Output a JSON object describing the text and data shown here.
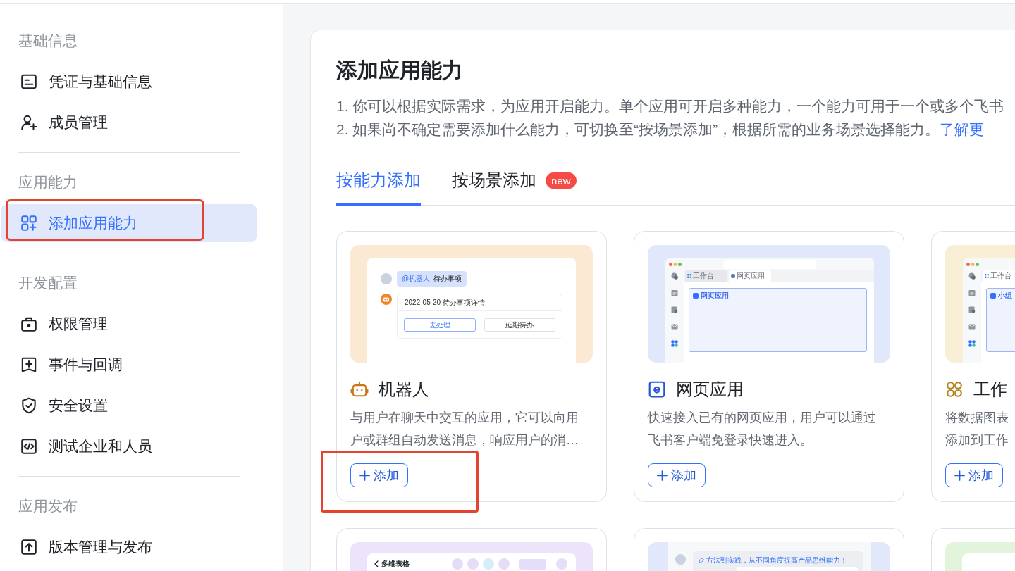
{
  "sidebar": {
    "sections": [
      {
        "title": "基础信息",
        "items": [
          {
            "label": "凭证与基础信息",
            "selected": false,
            "annotated": false
          },
          {
            "label": "成员管理",
            "selected": false,
            "annotated": false
          }
        ]
      },
      {
        "title": "应用能力",
        "items": [
          {
            "label": "添加应用能力",
            "selected": true,
            "annotated": true
          }
        ]
      },
      {
        "title": "开发配置",
        "items": [
          {
            "label": "权限管理",
            "selected": false,
            "annotated": false
          },
          {
            "label": "事件与回调",
            "selected": false,
            "annotated": false
          },
          {
            "label": "安全设置",
            "selected": false,
            "annotated": false
          },
          {
            "label": "测试企业和人员",
            "selected": false,
            "annotated": false
          }
        ]
      },
      {
        "title": "应用发布",
        "items": [
          {
            "label": "版本管理与发布",
            "selected": false,
            "annotated": false
          }
        ]
      }
    ]
  },
  "main": {
    "title": "添加应用能力",
    "notes": [
      {
        "text": "1. 你可以根据实际需求，为应用开启能力。单个应用可开启多种能力，一个能力可用于一个或多个飞书"
      },
      {
        "text": "2. 如果尚不确定需要添加什么能力，可切换至“按场景添加”，根据所需的业务场景选择能力。",
        "link": "了解更"
      }
    ],
    "tabs": [
      {
        "label": "按能力添加",
        "selected": true
      },
      {
        "label": "按场景添加",
        "selected": false,
        "badge": "new"
      }
    ],
    "cards": [
      {
        "kind": "bot",
        "title": "机器人",
        "description_lines": [
          "与用户在聊天中交互的应用，它可以向用",
          "户或群组自动发送消息，响应用户的消…"
        ],
        "button": "添加",
        "annotated": true,
        "illustration": {
          "kind": "chat",
          "color": "#fbe9d4",
          "mention": "@机器人",
          "message": "待办事项",
          "card_title": "2022-05-20 待办事项详情",
          "buttons": [
            {
              "label": "去处理",
              "primary": true
            },
            {
              "label": "延期待办",
              "primary": false
            }
          ]
        }
      },
      {
        "kind": "web_app",
        "title": "网页应用",
        "description_lines": [
          "快速接入已有的网页应用，用户可以通过",
          "飞书客户端免登录快速进入。"
        ],
        "button": "添加",
        "annotated": false,
        "illustration": {
          "kind": "window",
          "color": "#e1e8fb",
          "address_bar": true,
          "tabs": [
            {
              "label": "工作台",
              "kind": "apps",
              "selected": false
            },
            {
              "label": "网页应用",
              "kind": "page",
              "selected": true
            }
          ],
          "panel_title": "网页应用"
        }
      },
      {
        "kind": "workplace",
        "title": "工作",
        "description_lines": [
          "将数据图表",
          "添加到工作"
        ],
        "button": "添加",
        "annotated": false,
        "illustration": {
          "kind": "window",
          "color": "#f8efd6",
          "address_bar": false,
          "tabs": [
            {
              "label": "工作台",
              "kind": "apps",
              "selected": true
            }
          ],
          "panel_title": "小组"
        }
      },
      {
        "illustration": {
          "kind": "table",
          "color": "#ece4fb",
          "title": "多维表格"
        }
      },
      {
        "illustration": {
          "kind": "doc",
          "color": "#e1e8fb",
          "message": "方法到实践，从不同角度提高产品思维能力！"
        }
      },
      {
        "illustration": {
          "kind": "blank_window",
          "color": "#e3f4dc"
        }
      }
    ]
  }
}
